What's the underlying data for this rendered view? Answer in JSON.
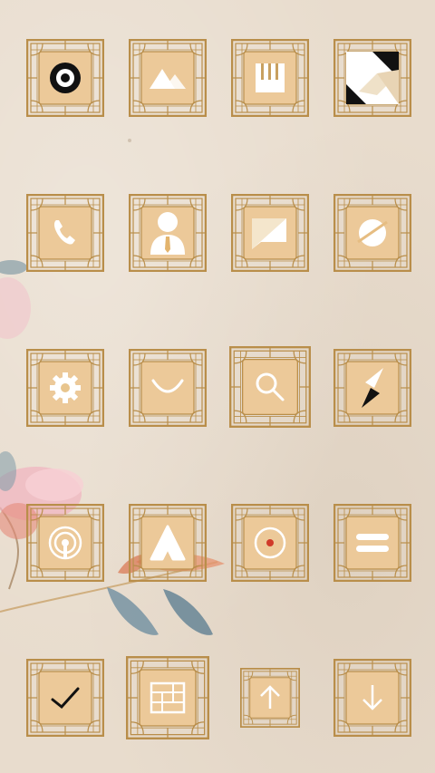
{
  "screen": {
    "name": "home-screen",
    "theme": {
      "frame_color": "#b98e4a",
      "tile_fill": "#ecc999",
      "background": "#e8dccd",
      "glyph_color": "#ffffff",
      "accent_red": "#d03a2a"
    }
  },
  "apps": [
    {
      "id": "camera",
      "icon": "record-ring-icon"
    },
    {
      "id": "gallery",
      "icon": "mountains-icon"
    },
    {
      "id": "music",
      "icon": "piano-keys-icon"
    },
    {
      "id": "launcher-theme",
      "icon": "geometric-tile-icon"
    },
    {
      "id": "phone",
      "icon": "phone-icon"
    },
    {
      "id": "contacts",
      "icon": "person-tie-icon"
    },
    {
      "id": "messages",
      "icon": "message-bubble-icon"
    },
    {
      "id": "browser",
      "icon": "planet-icon"
    },
    {
      "id": "settings",
      "icon": "gear-icon"
    },
    {
      "id": "store",
      "icon": "smile-icon"
    },
    {
      "id": "search",
      "icon": "magnifier-icon"
    },
    {
      "id": "compass",
      "icon": "compass-icon"
    },
    {
      "id": "radio",
      "icon": "broadcast-icon"
    },
    {
      "id": "app-a",
      "icon": "letter-a-icon"
    },
    {
      "id": "recorder",
      "icon": "record-dot-icon"
    },
    {
      "id": "menu",
      "icon": "equals-icon"
    },
    {
      "id": "clock",
      "icon": "clock-hands-icon"
    },
    {
      "id": "calendar",
      "icon": "grid-calendar-icon"
    },
    {
      "id": "upload",
      "icon": "arrow-up-icon"
    },
    {
      "id": "download",
      "icon": "arrow-down-icon"
    }
  ]
}
